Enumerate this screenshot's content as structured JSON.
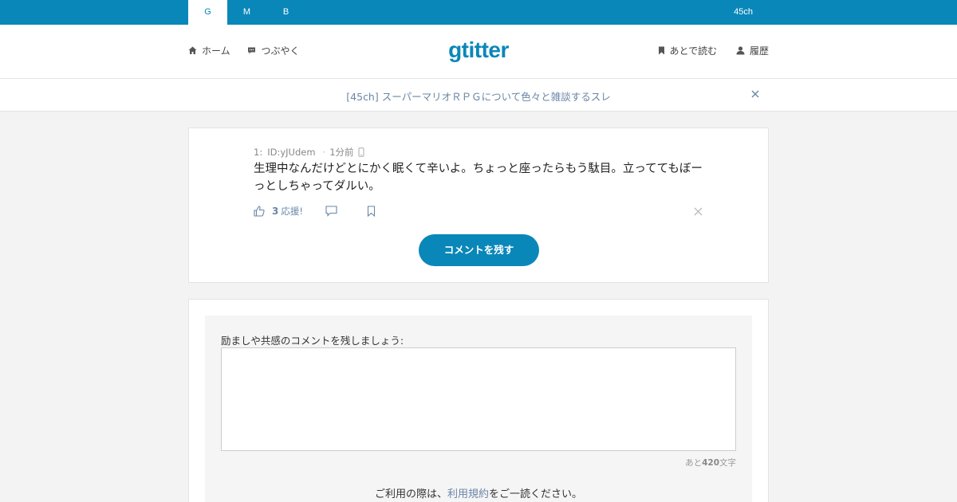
{
  "topbar": {
    "tabs": [
      {
        "label": "G",
        "active": true
      },
      {
        "label": "M",
        "active": false
      },
      {
        "label": "B",
        "active": false
      }
    ],
    "right_label": "45ch"
  },
  "header": {
    "logo": "gtitter",
    "nav_left": [
      {
        "label": "ホーム",
        "icon": "home-icon"
      },
      {
        "label": "つぶやく",
        "icon": "speech-bubble-icon"
      }
    ],
    "nav_right": [
      {
        "label": "あとで読む",
        "icon": "bookmark-icon"
      },
      {
        "label": "履歴",
        "icon": "user-icon"
      }
    ]
  },
  "thread": {
    "title": "[45ch] スーパーマリオＲＰＧについて色々と雑談するスレ"
  },
  "post": {
    "number": "1:",
    "id": "ID:yJUdem",
    "time": "1分前",
    "body": "生理中なんだけどとにかく眠くて辛いよ。ちょっと座ったらもう駄目。立っててもぼーっとしちゃってダルい。",
    "like_count": "3",
    "like_label": "応援!",
    "comment_button": "コメントを残す"
  },
  "form": {
    "label": "励ましや共感のコメントを残しましょう:",
    "value": "",
    "counter_prefix": "あと",
    "counter_value": "420",
    "counter_suffix": "文字",
    "terms_prefix": "ご利用の際は、",
    "terms_link": "利用規約",
    "terms_suffix": "をご一読ください。"
  },
  "colors": {
    "brand": "#0a87b9",
    "link": "#6a86a6",
    "background": "#f3f3f3"
  }
}
